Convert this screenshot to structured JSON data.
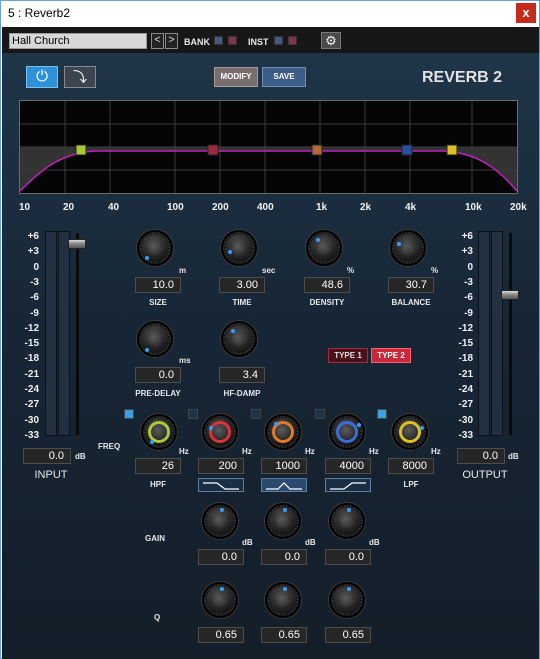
{
  "window": {
    "title": "5 : Reverb2",
    "close": "x"
  },
  "toolbar": {
    "preset": "Hall Church",
    "prev": "<",
    "next": ">",
    "bank": "BANK",
    "inst": "INST"
  },
  "plugin": {
    "name": "REVERB 2",
    "modify": "MODIFY",
    "save": "SAVE",
    "type1": "TYPE 1",
    "type2": "TYPE 2",
    "active_type": "TYPE 2"
  },
  "freq_axis": [
    "10",
    "20",
    "40",
    "100",
    "200",
    "400",
    "1k",
    "2k",
    "4k",
    "10k",
    "20k"
  ],
  "meter_scale": [
    "+6",
    "+3",
    "0",
    "-3",
    "-6",
    "-9",
    "-12",
    "-15",
    "-18",
    "-21",
    "-24",
    "-27",
    "-30",
    "-33"
  ],
  "input": {
    "value": "0.0",
    "unit": "dB",
    "label": "INPUT",
    "fader_level": 0.97
  },
  "output": {
    "value": "0.0",
    "unit": "dB",
    "label": "OUTPUT",
    "fader_level": 0.72
  },
  "main": [
    {
      "label": "SIZE",
      "value": "10.0",
      "unit": "m"
    },
    {
      "label": "TIME",
      "value": "3.00",
      "unit": "sec"
    },
    {
      "label": "DENSITY",
      "value": "48.6",
      "unit": "%"
    },
    {
      "label": "BALANCE",
      "value": "30.7",
      "unit": "%"
    },
    {
      "label": "PRE-DELAY",
      "value": "0.0",
      "unit": "ms"
    },
    {
      "label": "HF-DAMP",
      "value": "3.4",
      "unit": ""
    }
  ],
  "freq": {
    "label": "FREQ",
    "bands": [
      {
        "label": "HPF",
        "value": "26",
        "unit": "Hz"
      },
      {
        "label": "",
        "value": "200",
        "unit": "Hz"
      },
      {
        "label": "",
        "value": "1000",
        "unit": "Hz"
      },
      {
        "label": "",
        "value": "4000",
        "unit": "Hz"
      },
      {
        "label": "LPF",
        "value": "8000",
        "unit": "Hz"
      }
    ]
  },
  "gain": {
    "label": "GAIN",
    "bands": [
      {
        "value": "0.0",
        "unit": "dB"
      },
      {
        "value": "0.0",
        "unit": "dB"
      },
      {
        "value": "0.0",
        "unit": "dB"
      }
    ]
  },
  "q": {
    "label": "Q",
    "bands": [
      {
        "value": "0.65"
      },
      {
        "value": "0.65"
      },
      {
        "value": "0.65"
      }
    ]
  },
  "colors": {
    "accent": "#2e92d8",
    "hpf": "#a8c93a",
    "band1": "#e0303a",
    "band2": "#e07a2a",
    "band3": "#3a6fe0",
    "lpf": "#e0c020",
    "curve": "#c020c0"
  }
}
